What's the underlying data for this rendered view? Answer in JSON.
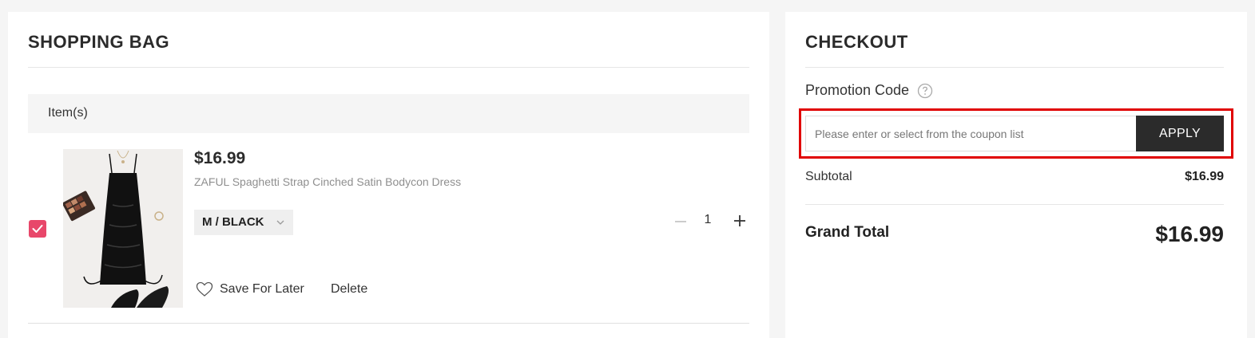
{
  "bag": {
    "title": "SHOPPING BAG",
    "items_header": "Item(s)",
    "item": {
      "price": "$16.99",
      "name": "ZAFUL Spaghetti Strap Cinched Satin Bodycon Dress",
      "variant": "M / BLACK",
      "quantity": "1",
      "checked": true,
      "save_for_later": "Save For Later",
      "delete": "Delete"
    }
  },
  "checkout": {
    "title": "CHECKOUT",
    "promo_label": "Promotion Code",
    "promo_placeholder": "Please enter or select from the coupon list",
    "apply_label": "APPLY",
    "subtotal_label": "Subtotal",
    "subtotal_value": "$16.99",
    "grand_total_label": "Grand Total",
    "grand_total_value": "$16.99"
  },
  "colors": {
    "accent": "#e8476a",
    "highlight": "#e00000",
    "button": "#2b2b2b"
  }
}
